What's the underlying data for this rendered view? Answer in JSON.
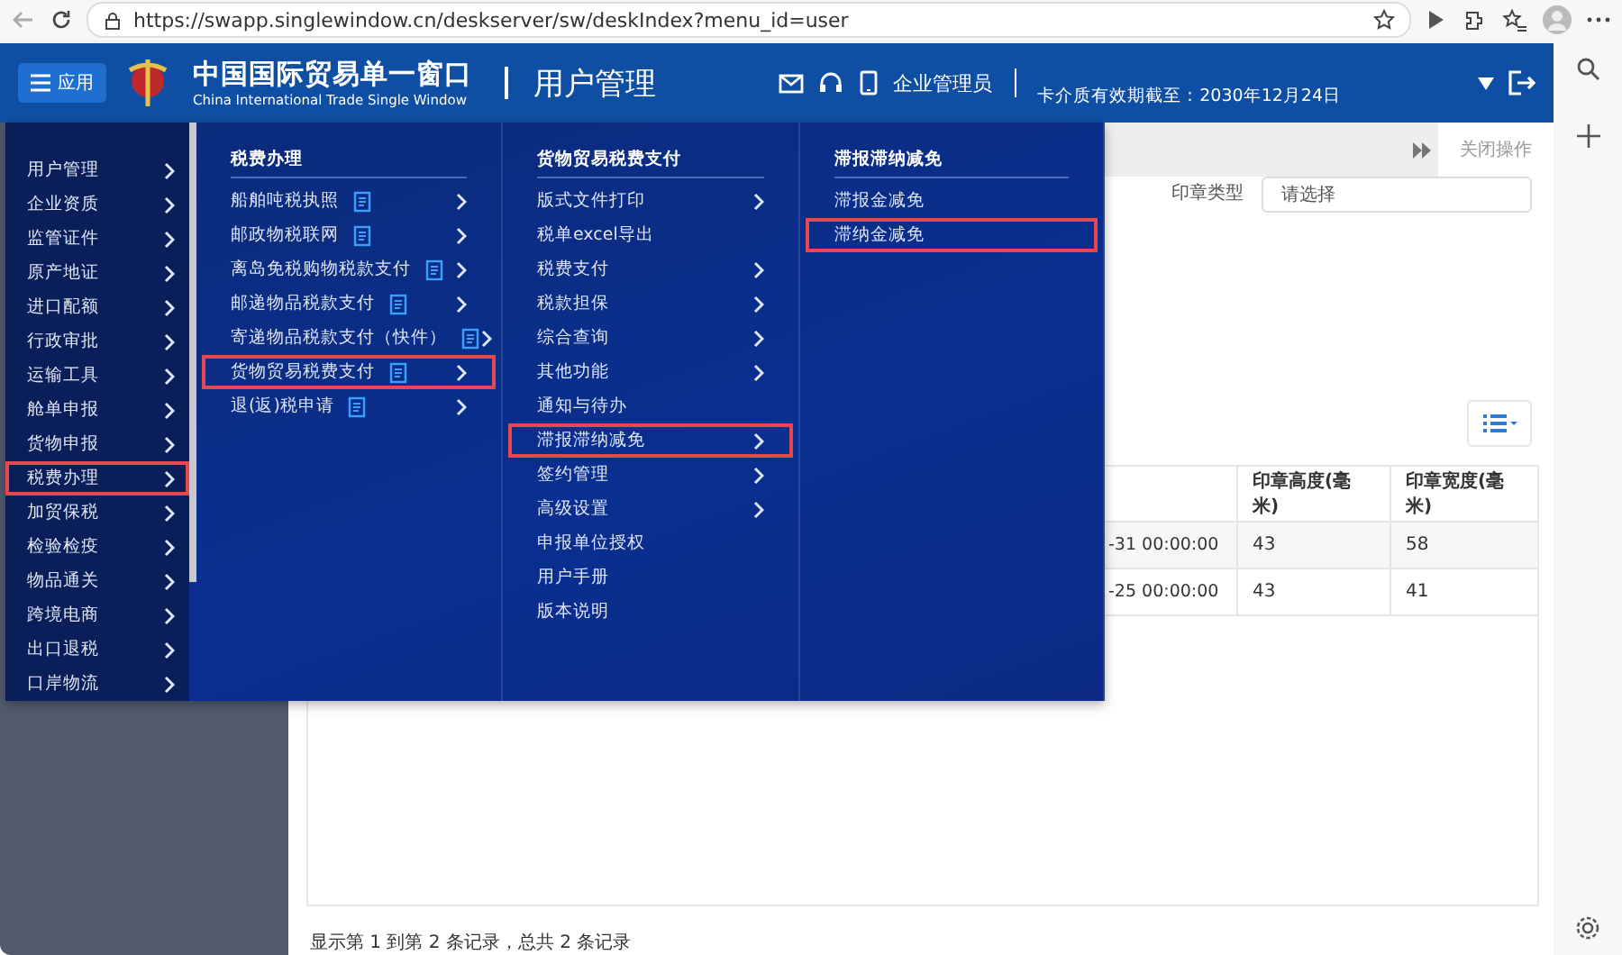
{
  "browser": {
    "url": "https://swapp.singlewindow.cn/deskserver/sw/deskIndex?menu_id=user"
  },
  "header": {
    "menu_button": "应用",
    "logo_cn": "中国国际贸易单一窗口",
    "logo_en": "China International Trade Single Window",
    "page_title": "用户管理",
    "user_role": "企业管理员",
    "card_expiry": "卡介质有效期截至：2030年12月24日"
  },
  "tabs_bar": {
    "close_action": "关闭操作"
  },
  "form": {
    "fields": [
      {
        "label": "印章类型",
        "placeholder": "请选择"
      }
    ]
  },
  "table": {
    "columns": [
      "",
      "印章高度(毫米)",
      "印章宽度(毫米)"
    ],
    "rows": [
      [
        "-31 00:00:00",
        "43",
        "58"
      ],
      [
        "-25 00:00:00",
        "43",
        "41"
      ]
    ]
  },
  "status_bar": "显示第 1 到第 2 条记录，总共 2 条记录",
  "mega_menu": {
    "categories": [
      {
        "label": "用户管理",
        "selected": false
      },
      {
        "label": "企业资质",
        "selected": false
      },
      {
        "label": "监管证件",
        "selected": false
      },
      {
        "label": "原产地证",
        "selected": false
      },
      {
        "label": "进口配额",
        "selected": false
      },
      {
        "label": "行政审批",
        "selected": false
      },
      {
        "label": "运输工具",
        "selected": false
      },
      {
        "label": "舱单申报",
        "selected": false
      },
      {
        "label": "货物申报",
        "selected": false
      },
      {
        "label": "税费办理",
        "selected": true
      },
      {
        "label": "加贸保税",
        "selected": false
      },
      {
        "label": "检验检疫",
        "selected": false
      },
      {
        "label": "物品通关",
        "selected": false
      },
      {
        "label": "跨境电商",
        "selected": false
      },
      {
        "label": "出口退税",
        "selected": false
      },
      {
        "label": "口岸物流",
        "selected": false
      }
    ],
    "panels": [
      {
        "title": "税费办理",
        "items": [
          {
            "label": "船舶吨税执照",
            "doc": true,
            "submenu": true,
            "selected": false
          },
          {
            "label": "邮政物税联网",
            "doc": true,
            "submenu": true,
            "selected": false
          },
          {
            "label": "离岛免税购物税款支付",
            "doc": true,
            "submenu": true,
            "selected": false
          },
          {
            "label": "邮递物品税款支付",
            "doc": true,
            "submenu": true,
            "selected": false
          },
          {
            "label": "寄递物品税款支付（快件）",
            "doc": true,
            "submenu": true,
            "selected": false
          },
          {
            "label": "货物贸易税费支付",
            "doc": true,
            "submenu": true,
            "selected": true
          },
          {
            "label": "退(返)税申请",
            "doc": true,
            "submenu": true,
            "selected": false
          }
        ]
      },
      {
        "title": "货物贸易税费支付",
        "items": [
          {
            "label": "版式文件打印",
            "doc": false,
            "submenu": true,
            "selected": false
          },
          {
            "label": "税单excel导出",
            "doc": false,
            "submenu": false,
            "selected": false
          },
          {
            "label": "税费支付",
            "doc": false,
            "submenu": true,
            "selected": false
          },
          {
            "label": "税款担保",
            "doc": false,
            "submenu": true,
            "selected": false
          },
          {
            "label": "综合查询",
            "doc": false,
            "submenu": true,
            "selected": false
          },
          {
            "label": "其他功能",
            "doc": false,
            "submenu": true,
            "selected": false
          },
          {
            "label": "通知与待办",
            "doc": false,
            "submenu": false,
            "selected": false
          },
          {
            "label": "滞报滞纳减免",
            "doc": false,
            "submenu": true,
            "selected": true
          },
          {
            "label": "签约管理",
            "doc": false,
            "submenu": true,
            "selected": false
          },
          {
            "label": "高级设置",
            "doc": false,
            "submenu": true,
            "selected": false
          },
          {
            "label": "申报单位授权",
            "doc": false,
            "submenu": false,
            "selected": false
          },
          {
            "label": "用户手册",
            "doc": false,
            "submenu": false,
            "selected": false
          },
          {
            "label": "版本说明",
            "doc": false,
            "submenu": false,
            "selected": false
          }
        ]
      },
      {
        "title": "滞报滞纳减免",
        "items": [
          {
            "label": "滞报金减免",
            "doc": false,
            "submenu": false,
            "selected": false
          },
          {
            "label": "滞纳金减免",
            "doc": false,
            "submenu": false,
            "selected": true
          }
        ]
      }
    ]
  }
}
